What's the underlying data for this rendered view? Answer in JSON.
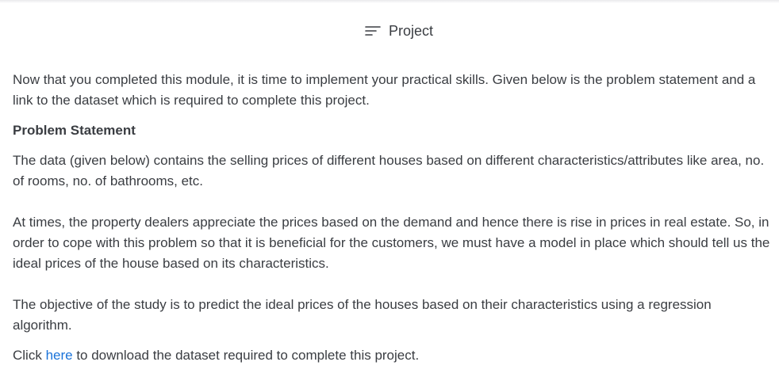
{
  "header": {
    "icon": "menu-lines-icon",
    "title": "Project"
  },
  "content": {
    "intro": "Now that you completed this module, it is time to implement your practical skills. Given below is the problem statement and a link to the dataset which is required to complete this project.",
    "heading": "Problem Statement",
    "paragraph1": "The data (given below) contains the selling prices of different houses based on different characteristics/attributes like area, no. of rooms, no. of bathrooms, etc.",
    "paragraph2": "At times, the property dealers appreciate the prices based on the demand and hence there is rise in prices in real estate. So, in order to cope with this problem so that it is beneficial for the customers, we must have a model in place which should tell us the ideal prices of the house based on its characteristics.",
    "paragraph3": "The objective of the study is to predict the ideal prices of the houses based on their characteristics using a regression algorithm.",
    "download": {
      "prefix": "Click ",
      "link_text": "here",
      "suffix": " to download the dataset required to complete this project."
    }
  },
  "colors": {
    "text": "#3a3d42",
    "link": "#1a73d9"
  }
}
